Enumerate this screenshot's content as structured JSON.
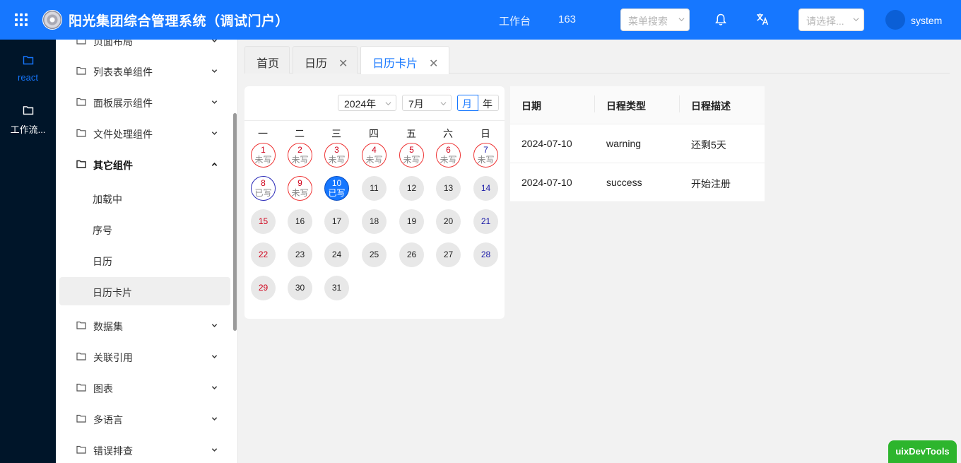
{
  "header": {
    "title": "阳光集团综合管理系统（调试门户）",
    "workbench": "工作台",
    "count": "163",
    "menu_search_placeholder": "菜单搜索",
    "select_placeholder": "请选择...",
    "username": "system",
    "bg_color": "#1677ff"
  },
  "rail": {
    "items": [
      {
        "label": "react",
        "icon": "folder-icon",
        "active": true
      },
      {
        "label": "工作流...",
        "icon": "folder-icon",
        "active": false
      }
    ]
  },
  "sidebar": {
    "items": [
      {
        "label": "页面布局",
        "icon": "folder-icon"
      },
      {
        "label": "列表表单组件",
        "icon": "folder-icon"
      },
      {
        "label": "面板展示组件",
        "icon": "folder-icon"
      },
      {
        "label": "文件处理组件",
        "icon": "folder-icon"
      },
      {
        "label": "其它组件",
        "icon": "folder-icon",
        "expanded": true
      },
      {
        "label": "加载中"
      },
      {
        "label": "序号"
      },
      {
        "label": "日历"
      },
      {
        "label": "日历卡片",
        "active": true
      },
      {
        "label": "数据集",
        "icon": "folder-icon"
      },
      {
        "label": "关联引用",
        "icon": "folder-icon"
      },
      {
        "label": "图表",
        "icon": "folder-icon"
      },
      {
        "label": "多语言",
        "icon": "folder-icon"
      },
      {
        "label": "错误排查",
        "icon": "folder-icon"
      }
    ]
  },
  "tabs": [
    {
      "label": "首页",
      "closable": false,
      "active": false
    },
    {
      "label": "日历",
      "closable": true,
      "active": false
    },
    {
      "label": "日历卡片",
      "closable": true,
      "active": true
    }
  ],
  "tab_close_glyph": "✕",
  "calendar": {
    "year": "2024年",
    "month": "7月",
    "mode_month": "月",
    "mode_year": "年",
    "weekdays": [
      "一",
      "二",
      "三",
      "四",
      "五",
      "六",
      "日"
    ],
    "days": [
      {
        "n": "1",
        "status": "未写"
      },
      {
        "n": "2",
        "status": "未写"
      },
      {
        "n": "3",
        "status": "未写"
      },
      {
        "n": "4",
        "status": "未写"
      },
      {
        "n": "5",
        "status": "未写"
      },
      {
        "n": "6",
        "status": "未写"
      },
      {
        "n": "7",
        "status": "未写"
      },
      {
        "n": "8",
        "status": "已写"
      },
      {
        "n": "9",
        "status": "未写"
      },
      {
        "n": "10",
        "status": "已写"
      },
      {
        "n": "11"
      },
      {
        "n": "12"
      },
      {
        "n": "13"
      },
      {
        "n": "14"
      },
      {
        "n": "15"
      },
      {
        "n": "16"
      },
      {
        "n": "17"
      },
      {
        "n": "18"
      },
      {
        "n": "19"
      },
      {
        "n": "20"
      },
      {
        "n": "21"
      },
      {
        "n": "22"
      },
      {
        "n": "23"
      },
      {
        "n": "24"
      },
      {
        "n": "25"
      },
      {
        "n": "26"
      },
      {
        "n": "27"
      },
      {
        "n": "28"
      },
      {
        "n": "29"
      },
      {
        "n": "30"
      },
      {
        "n": "31"
      }
    ]
  },
  "schedule": {
    "headers": [
      "日期",
      "日程类型",
      "日程描述"
    ],
    "rows": [
      [
        "2024-07-10",
        "warning",
        "还剩5天"
      ],
      [
        "2024-07-10",
        "success",
        "开始注册"
      ]
    ]
  },
  "devtools_label": "uixDevTools"
}
